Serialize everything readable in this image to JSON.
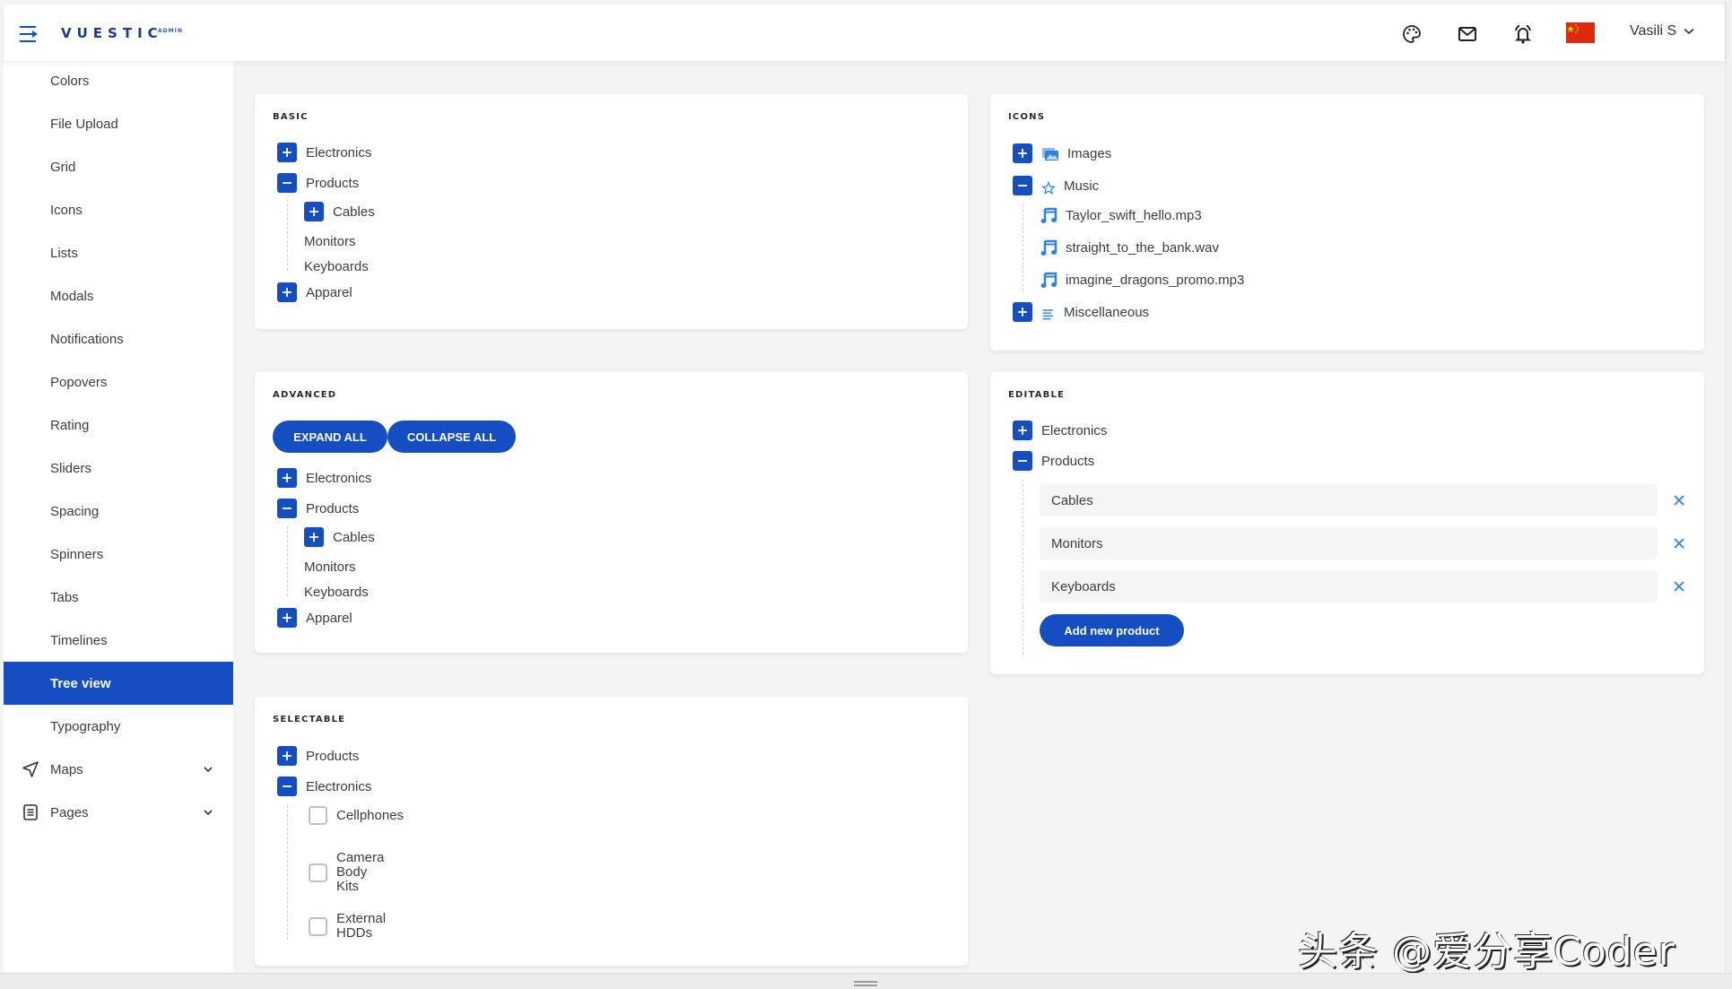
{
  "header": {
    "logo": "VUESTIC",
    "logo_sup": "ADMIN",
    "icons": [
      "menu-toggle-icon",
      "palette-icon",
      "mail-icon",
      "bell-icon",
      "flag-cn-icon"
    ],
    "user_name": "Vasili S"
  },
  "sidebar": {
    "items": [
      {
        "label": "Colors"
      },
      {
        "label": "File Upload"
      },
      {
        "label": "Grid"
      },
      {
        "label": "Icons"
      },
      {
        "label": "Lists"
      },
      {
        "label": "Modals"
      },
      {
        "label": "Notifications"
      },
      {
        "label": "Popovers"
      },
      {
        "label": "Rating"
      },
      {
        "label": "Sliders"
      },
      {
        "label": "Spacing"
      },
      {
        "label": "Spinners"
      },
      {
        "label": "Tabs"
      },
      {
        "label": "Timelines"
      },
      {
        "label": "Tree view",
        "active": true
      },
      {
        "label": "Typography"
      },
      {
        "label": "Maps",
        "icon": "navigation-icon",
        "expandable": true
      },
      {
        "label": "Pages",
        "icon": "document-icon",
        "expandable": true
      }
    ]
  },
  "cards": {
    "basic": {
      "title": "BASIC",
      "items": [
        "Electronics",
        "Products",
        "Cables",
        "Monitors",
        "Keyboards",
        "Apparel"
      ]
    },
    "icons": {
      "title": "ICONS",
      "items": [
        "Images",
        "Music",
        "Taylor_swift_hello.mp3",
        "straight_to_the_bank.wav",
        "imagine_dragons_promo.mp3",
        "Miscellaneous"
      ]
    },
    "advanced": {
      "title": "ADVANCED",
      "expand_all": "EXPAND ALL",
      "collapse_all": "COLLAPSE ALL",
      "items": [
        "Electronics",
        "Products",
        "Cables",
        "Monitors",
        "Keyboards",
        "Apparel"
      ]
    },
    "editable": {
      "title": "EDITABLE",
      "items": [
        "Electronics",
        "Products"
      ],
      "fields": [
        "Cables",
        "Monitors",
        "Keyboards"
      ],
      "add_button": "Add new product"
    },
    "selectable": {
      "title": "SELECTABLE",
      "items": [
        "Products",
        "Electronics"
      ],
      "checkboxes": [
        {
          "label": "Cellphones",
          "checked": false
        },
        {
          "label": "Camera Body Kits",
          "checked": false
        },
        {
          "label": "External HDDs",
          "checked": false
        }
      ]
    }
  },
  "colors": {
    "primary": "#154ec1",
    "icon_blue": "#2c82e0"
  },
  "watermark": "头条 @爱分享Coder"
}
